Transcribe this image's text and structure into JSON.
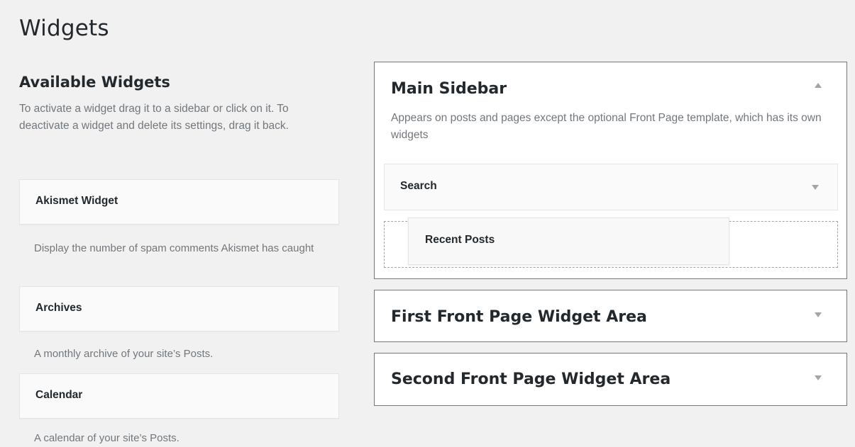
{
  "page": {
    "title": "Widgets"
  },
  "available": {
    "heading": "Available Widgets",
    "description": "To activate a widget drag it to a sidebar or click on it. To deactivate a widget and delete its settings, drag it back.",
    "widgets": [
      {
        "title": "Akismet Widget",
        "description": "Display the number of spam comments Akismet has caught"
      },
      {
        "title": "Archives",
        "description": "A monthly archive of your site’s Posts."
      },
      {
        "title": "Calendar",
        "description": "A calendar of your site’s Posts."
      }
    ]
  },
  "sidebars": [
    {
      "title": "Main Sidebar",
      "expanded": true,
      "arrow_icon": "triangle-up-icon",
      "description": "Appears on posts and pages except the optional Front Page template, which has its own widgets",
      "widgets": [
        {
          "title": "Search",
          "arrow_icon": "triangle-down-icon"
        }
      ],
      "dragging_widget": {
        "title": "Recent Posts"
      }
    },
    {
      "title": "First Front Page Widget Area",
      "expanded": false,
      "arrow_icon": "triangle-down-icon"
    },
    {
      "title": "Second Front Page Widget Area",
      "expanded": false,
      "arrow_icon": "triangle-down-icon"
    }
  ],
  "colors": {
    "background": "#f1f1f1",
    "text": "#23282d",
    "muted_text": "#72777c",
    "border": "#72777c",
    "arrow": "#a0a5aa"
  }
}
